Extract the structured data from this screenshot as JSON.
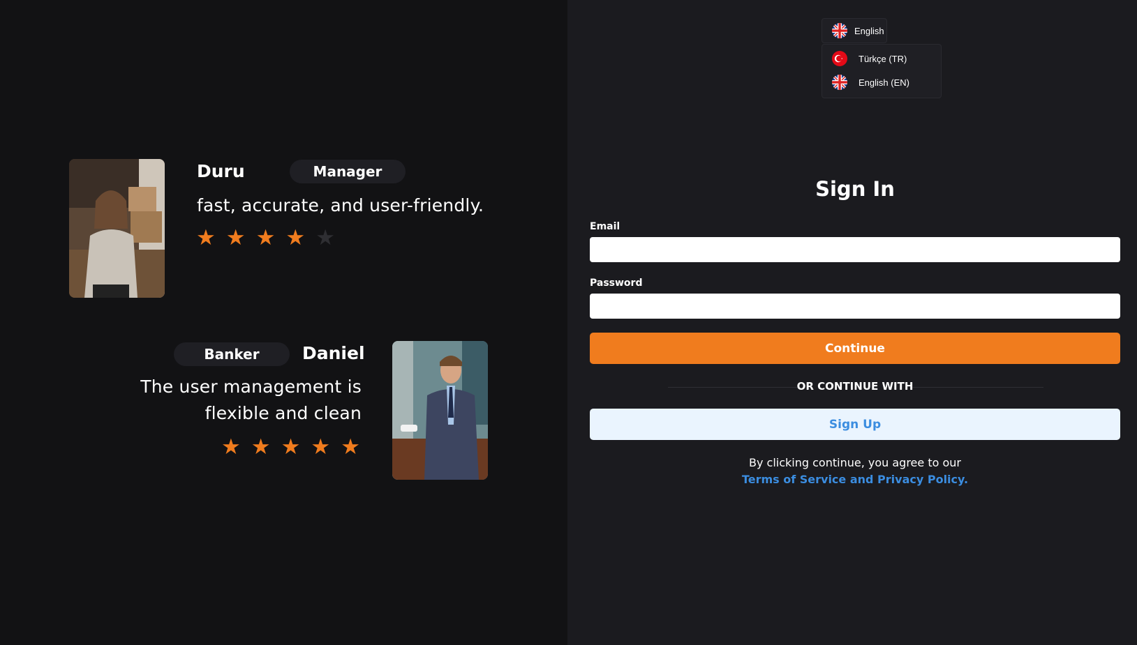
{
  "testimonials": [
    {
      "name": "Duru",
      "role": "Manager",
      "quote": "fast, accurate, and user-friendly.",
      "rating": 4,
      "max_rating": 5
    },
    {
      "name": "Daniel",
      "role": "Banker",
      "quote_line1": "The user management is",
      "quote_line2": "flexible and clean",
      "rating": 5,
      "max_rating": 5
    }
  ],
  "language": {
    "current": "English",
    "options": [
      {
        "label": "Türkçe (TR)",
        "flag": "turkey-flag-icon"
      },
      {
        "label": "English (EN)",
        "flag": "uk-flag-icon"
      }
    ]
  },
  "form": {
    "title": "Sign In",
    "email_label": "Email",
    "email_value": "",
    "password_label": "Password",
    "password_value": "",
    "continue_label": "Continue",
    "divider_text": "OR CONTINUE WITH",
    "signup_label": "Sign Up",
    "agree_text": "By clicking continue, you agree to our",
    "terms_link": "Terms of Service and Privacy Policy."
  },
  "colors": {
    "accent": "#f07c1e",
    "link": "#3b8de0",
    "left_bg": "#121214",
    "right_bg": "#1b1b1f"
  }
}
